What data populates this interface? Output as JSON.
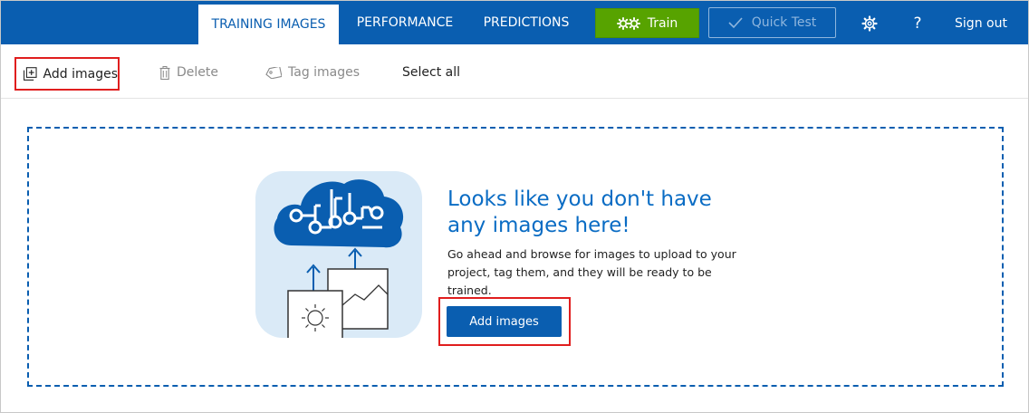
{
  "nav": {
    "tabs": [
      {
        "label": "TRAINING IMAGES",
        "active": true
      },
      {
        "label": "PERFORMANCE",
        "active": false
      },
      {
        "label": "PREDICTIONS",
        "active": false
      }
    ],
    "train_label": "Train",
    "quick_test_label": "Quick Test",
    "help_label": "?",
    "sign_out_label": "Sign out",
    "icons": {
      "train": "gears-icon",
      "quick_test": "checkmark-icon",
      "settings": "gear-icon"
    }
  },
  "toolbar": {
    "add_images_label": "Add images",
    "delete_label": "Delete",
    "tag_images_label": "Tag images",
    "select_all_label": "Select all",
    "icons": {
      "add": "add-image-icon",
      "delete": "trash-icon",
      "tag": "tag-icon"
    }
  },
  "empty_state": {
    "heading": "Looks like you don't have any images here!",
    "description": "Go ahead and browse for images to upload to your project, tag them, and they will be ready to be trained.",
    "button_label": "Add images",
    "illustration": "cloud-upload-images-illustration"
  },
  "colors": {
    "brand_blue": "#0a5eb0",
    "train_green": "#57a300",
    "heading_blue": "#0a6cc4",
    "highlight_red": "#e01e1e"
  }
}
